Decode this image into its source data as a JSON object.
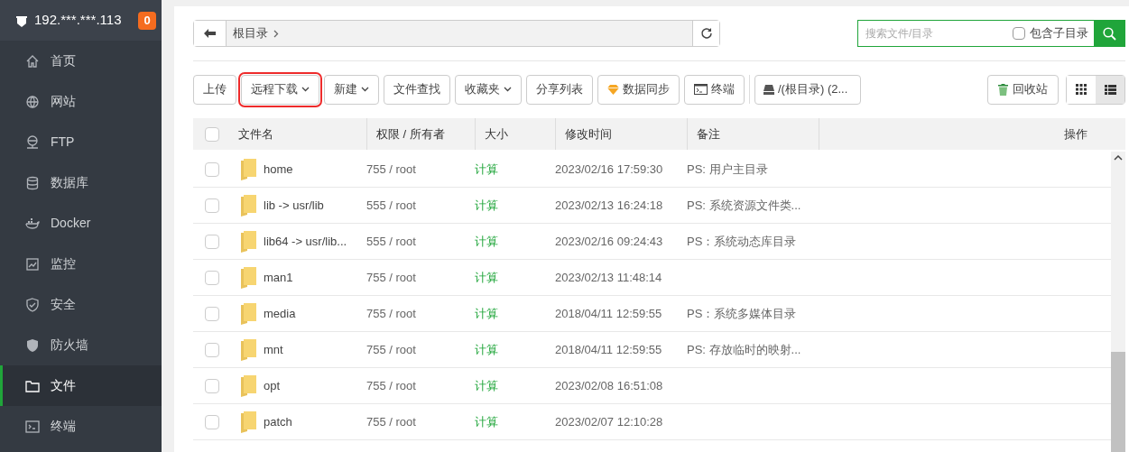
{
  "sidebar": {
    "host": "192.***.***.113",
    "badge": "0",
    "items": [
      {
        "label": "首页",
        "kind": "home",
        "selected": false
      },
      {
        "label": "网站",
        "kind": "globe",
        "selected": false
      },
      {
        "label": "FTP",
        "kind": "ftp",
        "selected": false
      },
      {
        "label": "数据库",
        "kind": "database",
        "selected": false
      },
      {
        "label": "Docker",
        "kind": "docker",
        "selected": false
      },
      {
        "label": "监控",
        "kind": "monitor",
        "selected": false
      },
      {
        "label": "安全",
        "kind": "shield",
        "selected": false
      },
      {
        "label": "防火墙",
        "kind": "firewall",
        "selected": false
      },
      {
        "label": "文件",
        "kind": "folder",
        "selected": true
      },
      {
        "label": "终端",
        "kind": "terminal",
        "selected": false
      }
    ]
  },
  "breadcrumb": {
    "segments": [
      "根目录"
    ]
  },
  "search": {
    "placeholder": "搜索文件/目录",
    "include_subdirs": {
      "label": "包含子目录",
      "checked": false
    }
  },
  "toolbar": [
    {
      "label": "上传",
      "dropdown": false,
      "highlighted": false,
      "kind": "plain"
    },
    {
      "label": "远程下载",
      "dropdown": true,
      "highlighted": true,
      "kind": "plain"
    },
    {
      "label": "新建",
      "dropdown": true,
      "highlighted": false,
      "kind": "plain"
    },
    {
      "label": "文件查找",
      "dropdown": false,
      "highlighted": false,
      "kind": "plain"
    },
    {
      "label": "收藏夹",
      "dropdown": true,
      "highlighted": false,
      "kind": "plain"
    },
    {
      "label": "分享列表",
      "dropdown": false,
      "highlighted": false,
      "kind": "plain"
    },
    {
      "label": "数据同步",
      "dropdown": false,
      "highlighted": false,
      "kind": "sync"
    },
    {
      "label": "终端",
      "dropdown": false,
      "highlighted": false,
      "kind": "terminal"
    }
  ],
  "drive_button": "/(根目录) (2...",
  "recycle_button": "回收站",
  "view_modes": [
    {
      "kind": "grid",
      "selected": false
    },
    {
      "kind": "list",
      "selected": true
    }
  ],
  "table": {
    "select_all": {
      "checked": false
    },
    "columns": [
      "文件名",
      "权限 / 所有者",
      "大小",
      "修改时间",
      "备注",
      "操作"
    ],
    "rows": [
      {
        "checked": false,
        "name": "home",
        "permissions": "755 / root",
        "size": "计算",
        "modified": "2023/02/16 17:59:30",
        "note": "PS: 用户主目录"
      },
      {
        "checked": false,
        "name": "lib -> usr/lib",
        "permissions": "555 / root",
        "size": "计算",
        "modified": "2023/02/13 16:24:18",
        "note": "PS: 系统资源文件类..."
      },
      {
        "checked": false,
        "name": "lib64 -> usr/lib...",
        "permissions": "555 / root",
        "size": "计算",
        "modified": "2023/02/16 09:24:43",
        "note": "PS：系统动态库目录"
      },
      {
        "checked": false,
        "name": "man1",
        "permissions": "755 / root",
        "size": "计算",
        "modified": "2023/02/13 11:48:14"
      },
      {
        "checked": false,
        "name": "media",
        "permissions": "755 / root",
        "size": "计算",
        "modified": "2018/04/11 12:59:55",
        "note": "PS：系统多媒体目录"
      },
      {
        "checked": false,
        "name": "mnt",
        "permissions": "755 / root",
        "size": "计算",
        "modified": "2018/04/11 12:59:55",
        "note": "PS: 存放临时的映射..."
      },
      {
        "checked": false,
        "name": "opt",
        "permissions": "755 / root",
        "size": "计算",
        "modified": "2023/02/08 16:51:08"
      },
      {
        "checked": false,
        "name": "patch",
        "permissions": "755 / root",
        "size": "计算",
        "modified": "2023/02/07 12:10:28"
      }
    ]
  }
}
